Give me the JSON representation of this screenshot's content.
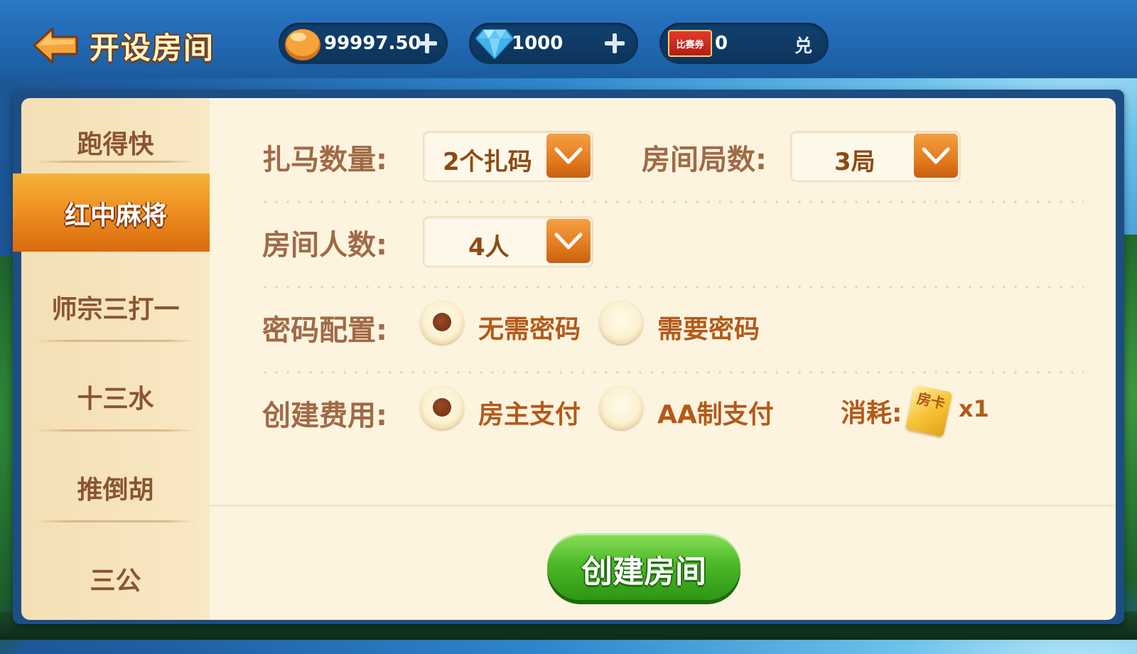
{
  "header": {
    "title": "开设房间",
    "beans": "99997.50",
    "diamonds": "1000",
    "ticket_badge": "比赛券",
    "tickets": "0",
    "exchange_label": "兑"
  },
  "sidebar": {
    "items": [
      {
        "label": "跑得快"
      },
      {
        "label": "红中麻将",
        "active": true
      },
      {
        "label": "师宗三打一"
      },
      {
        "label": "十三水"
      },
      {
        "label": "推倒胡"
      },
      {
        "label": "三公"
      }
    ]
  },
  "settings": {
    "zhama_label": "扎马数量:",
    "zhama_value": "2个扎码",
    "rounds_label": "房间局数:",
    "rounds_value": "3局",
    "players_label": "房间人数:",
    "players_value": "4人",
    "password_label": "密码配置:",
    "password_options": [
      "无需密码",
      "需要密码"
    ],
    "password_selected": 0,
    "fee_label": "创建费用:",
    "fee_options": [
      "房主支付",
      "AA制支付"
    ],
    "fee_selected": 0,
    "cost_label": "消耗:",
    "card_text": "房卡",
    "cost_value": "x1"
  },
  "create_button": "创建房间",
  "colors": {
    "accent_orange": "#e47a1e",
    "button_green": "#4cb928",
    "label_brown": "#a06a47"
  }
}
